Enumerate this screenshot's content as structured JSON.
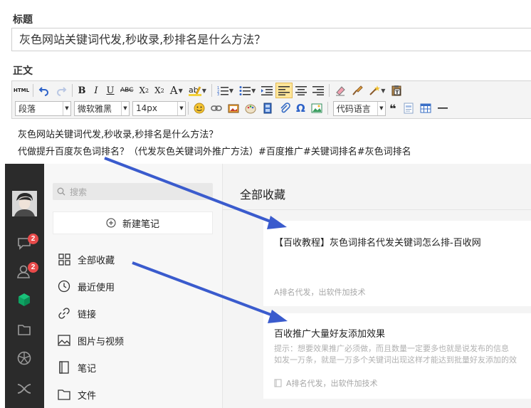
{
  "editor": {
    "title_label": "标题",
    "title_value": "灰色网站关键词代发,秒收录,秒排名是什么方法？",
    "body_label": "正文",
    "toolbar": {
      "html_label": "HTML",
      "paragraph_select": "段落",
      "font_select": "微软雅黑",
      "size_select": "14px",
      "code_lang_select": "代码语言"
    },
    "body_lines": [
      "灰色网站关键词代发,秒收录,秒排名是什么方法？",
      "代做提升百度灰色词排名？（代发灰色关键词外推广方法）#百度推广#关键词排名#灰色词排名"
    ]
  },
  "app": {
    "rail": {
      "chat_badge": "2",
      "contacts_badge": "2"
    },
    "search_placeholder": "搜索",
    "new_note_label": "新建笔记",
    "nav": [
      {
        "label": "全部收藏",
        "icon": "grid-icon"
      },
      {
        "label": "最近使用",
        "icon": "clock-icon"
      },
      {
        "label": "链接",
        "icon": "link-icon"
      },
      {
        "label": "图片与视频",
        "icon": "image-icon"
      },
      {
        "label": "笔记",
        "icon": "note-icon"
      },
      {
        "label": "文件",
        "icon": "folder-icon"
      }
    ],
    "content_title": "全部收藏",
    "cards": [
      {
        "title": "【百收教程】灰色词排名代发关键词怎么排-百收网",
        "meta": "A排名代发，出软件加技术"
      },
      {
        "title": "百收推广大量好友添加效果",
        "snippet_lines": [
          "提示：想要效果推广必须做，而且数量一定要多也就是说发布的信息",
          "如发一万条，就是一万多个关键词出现这样才能达到批量好友添加的效"
        ],
        "meta": "A排名代发，出软件加技术"
      }
    ]
  },
  "colors": {
    "arrow": "#3a5bcd",
    "rail_bg": "#2b2b2b",
    "badge": "#e84a4a",
    "active_btn": "#ffe69a"
  }
}
